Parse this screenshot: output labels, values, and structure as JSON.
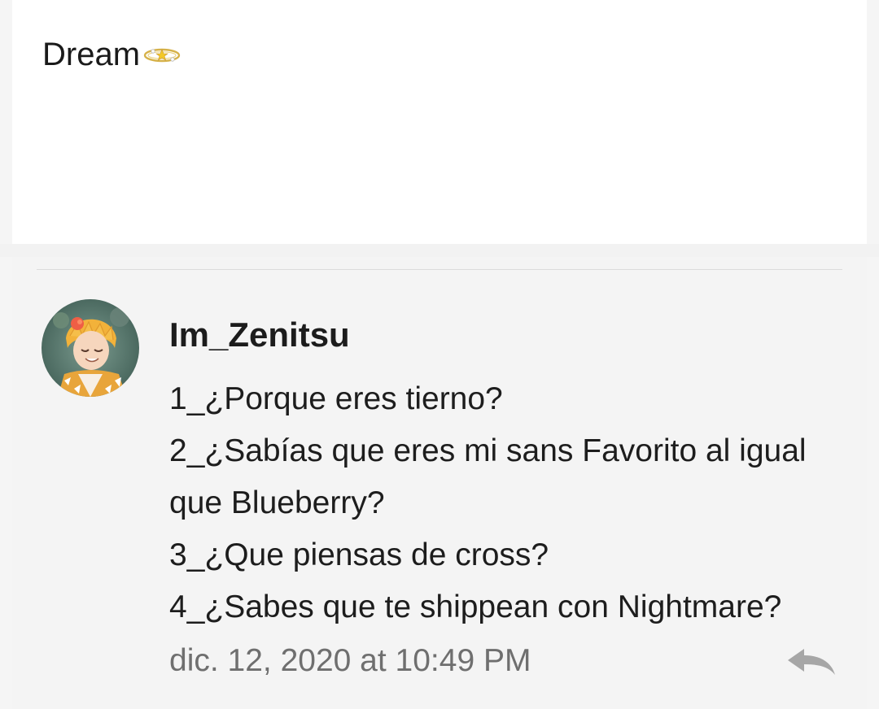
{
  "post": {
    "text": "Dream",
    "decoration_icon": "ring-icon"
  },
  "comment": {
    "username": "Im_Zenitsu",
    "avatar_icon": "avatar-anime-character",
    "lines": [
      "1_¿Porque eres tierno?",
      "2_¿Sabías que eres mi sans Favorito al igual",
      "que Blueberry?",
      "3_¿Que piensas de cross?",
      "4_¿Sabes que te shippean con Nightmare?"
    ],
    "timestamp": "dic. 12, 2020 at 10:49 PM",
    "reply_icon": "reply-icon"
  },
  "colors": {
    "page_background": "#f5f5f5",
    "post_card": "#ffffff",
    "comment_card": "#f4f4f4",
    "timestamp_text": "#6f6f6f",
    "reply_icon": "#a6a6a6"
  }
}
